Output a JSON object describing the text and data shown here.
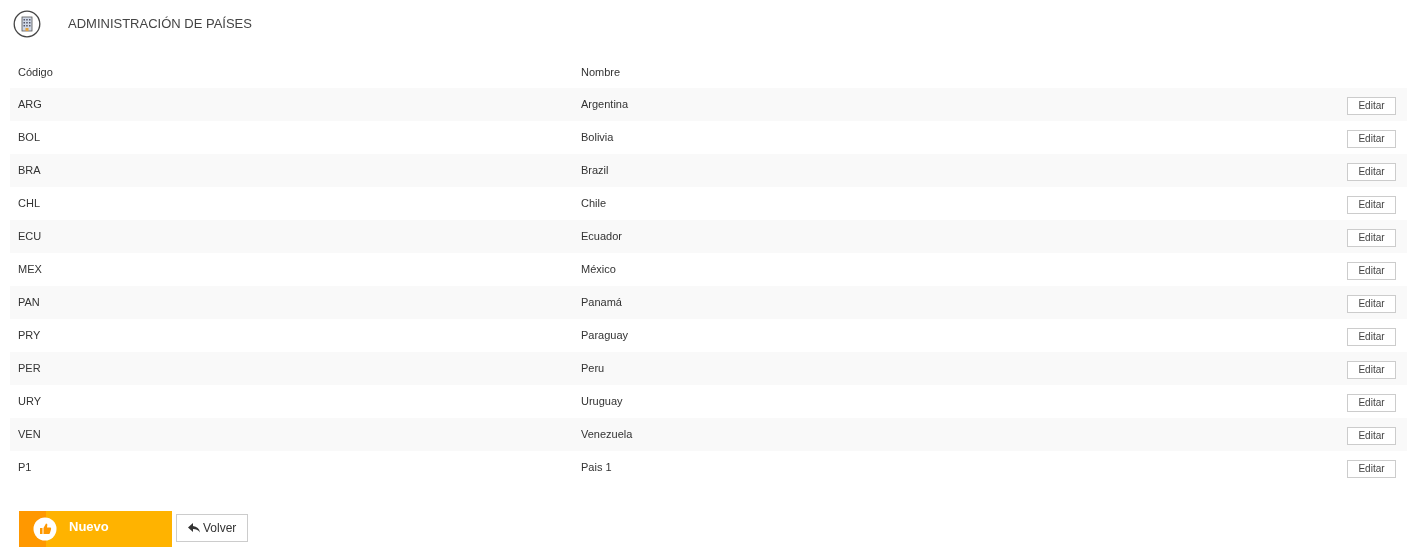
{
  "title": "ADMINISTRACIÓN DE PAÍSES",
  "table": {
    "columns": [
      "Código",
      "Nombre"
    ],
    "rows": [
      {
        "code": "ARG",
        "name": "Argentina",
        "action": "Editar"
      },
      {
        "code": "BOL",
        "name": "Bolivia",
        "action": "Editar"
      },
      {
        "code": "BRA",
        "name": "Brazil",
        "action": "Editar"
      },
      {
        "code": "CHL",
        "name": "Chile",
        "action": "Editar"
      },
      {
        "code": "ECU",
        "name": "Ecuador",
        "action": "Editar"
      },
      {
        "code": "MEX",
        "name": "México",
        "action": "Editar"
      },
      {
        "code": "PAN",
        "name": "Panamá",
        "action": "Editar"
      },
      {
        "code": "PRY",
        "name": "Paraguay",
        "action": "Editar"
      },
      {
        "code": "PER",
        "name": "Peru",
        "action": "Editar"
      },
      {
        "code": "URY",
        "name": "Uruguay",
        "action": "Editar"
      },
      {
        "code": "VEN",
        "name": "Venezuela",
        "action": "Editar"
      },
      {
        "code": "P1",
        "name": "Pais 1",
        "action": "Editar"
      }
    ]
  },
  "buttons": {
    "new": "Nuevo",
    "back": "Volver"
  }
}
